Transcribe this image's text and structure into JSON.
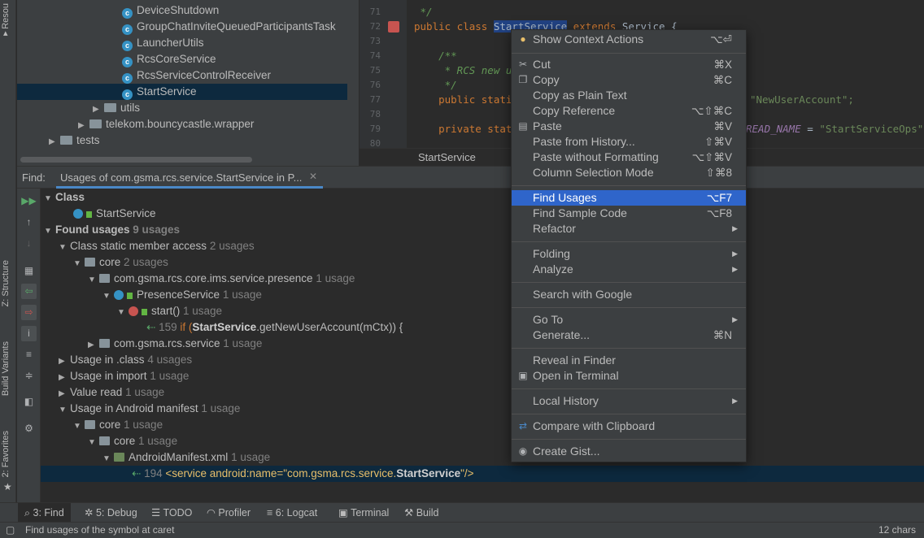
{
  "left_strip": {
    "resource": "Resou",
    "structure": "Z: Structure",
    "build_variants": "Build Variants",
    "favorites": "2: Favorites"
  },
  "project_tree": [
    {
      "label": "DeviceShutdown",
      "type": "class"
    },
    {
      "label": "GroupChatInviteQueuedParticipantsTask",
      "type": "class"
    },
    {
      "label": "LauncherUtils",
      "type": "class"
    },
    {
      "label": "RcsCoreService",
      "type": "class"
    },
    {
      "label": "RcsServiceControlReceiver",
      "type": "class"
    },
    {
      "label": "StartService",
      "type": "class",
      "selected": true
    },
    {
      "label": "utils",
      "type": "folder"
    },
    {
      "label": "telekom.bouncycastle.wrapper",
      "type": "folder"
    },
    {
      "label": "tests",
      "type": "folder"
    }
  ],
  "editor": {
    "lines": [
      {
        "n": "71",
        "text": " */"
      },
      {
        "n": "72",
        "k": "public class ",
        "h": "StartService",
        "k2": " extends ",
        "r": "Service {"
      },
      {
        "n": "73",
        "text": ""
      },
      {
        "n": "74",
        "text": "    /**"
      },
      {
        "n": "75",
        "text": "     * RCS new us"
      },
      {
        "n": "76",
        "text": "     */"
      },
      {
        "n": "77",
        "k": "    public static",
        "tail": "\"NewUserAccount\";"
      },
      {
        "n": "78",
        "text": ""
      },
      {
        "n": "79",
        "k": "    private stati",
        "tail2": "READ_NAME",
        "tail3": " = ",
        "tail4": "\"StartServiceOps\";"
      },
      {
        "n": "80",
        "text": ""
      }
    ],
    "breadcrumb": "StartService"
  },
  "find": {
    "label": "Find:",
    "tab": "Usages of com.gsma.rcs.service.StartService in P...",
    "rows": [
      {
        "depth": 0,
        "arrow": "▼",
        "text": "Class",
        "bold": true
      },
      {
        "depth": 1,
        "icon": "class",
        "text": "StartService"
      },
      {
        "depth": 0,
        "arrow": "▼",
        "text": "Found usages",
        "bold": true,
        "count": "9 usages"
      },
      {
        "depth": 1,
        "arrow": "▼",
        "text": "Class static member access",
        "count": "2 usages"
      },
      {
        "depth": 2,
        "arrow": "▼",
        "icon": "module",
        "text": "core",
        "count": "2 usages"
      },
      {
        "depth": 3,
        "arrow": "▼",
        "icon": "package",
        "text": "com.gsma.rcs.core.ims.service.presence",
        "count": "1 usage"
      },
      {
        "depth": 4,
        "arrow": "▼",
        "icon": "class",
        "text": "PresenceService",
        "count": "1 usage"
      },
      {
        "depth": 5,
        "arrow": "▼",
        "icon": "method",
        "text": "start()",
        "count": "1 usage"
      },
      {
        "depth": 6,
        "icon": "usage",
        "line": "159",
        "pre": "if (",
        "strong": "StartService",
        "post": ".getNewUserAccount(mCtx)) {"
      },
      {
        "depth": 3,
        "arrow": "▶",
        "icon": "package",
        "text": "com.gsma.rcs.service",
        "count": "1 usage"
      },
      {
        "depth": 1,
        "arrow": "▶",
        "text": "Usage in .class",
        "count": "4 usages"
      },
      {
        "depth": 1,
        "arrow": "▶",
        "text": "Usage in import",
        "count": "1 usage"
      },
      {
        "depth": 1,
        "arrow": "▶",
        "text": "Value read",
        "count": "1 usage"
      },
      {
        "depth": 1,
        "arrow": "▼",
        "text": "Usage in Android manifest",
        "count": "1 usage"
      },
      {
        "depth": 2,
        "arrow": "▼",
        "icon": "module",
        "text": "core",
        "count": "1 usage"
      },
      {
        "depth": 3,
        "arrow": "▼",
        "icon": "module2",
        "text": "core",
        "count": "1 usage"
      },
      {
        "depth": 4,
        "arrow": "▼",
        "icon": "xml",
        "text": "AndroidManifest.xml",
        "count": "1 usage"
      },
      {
        "depth": 5,
        "icon": "usage",
        "line": "194",
        "pre": "<service android:name=\"com.gsma.rcs.service.",
        "strong": "StartService",
        "post": "\"/>",
        "selected": true
      }
    ]
  },
  "context_menu": {
    "items": [
      {
        "icon": "bulb-icon",
        "label": "Show Context Actions",
        "shortcut": "⌥⏎"
      },
      {
        "sep": true
      },
      {
        "icon": "cut-icon",
        "label": "Cut",
        "shortcut": "⌘X"
      },
      {
        "icon": "copy-icon",
        "label": "Copy",
        "shortcut": "⌘C"
      },
      {
        "label": "Copy as Plain Text"
      },
      {
        "label": "Copy Reference",
        "shortcut": "⌥⇧⌘C"
      },
      {
        "icon": "paste-icon",
        "label": "Paste",
        "shortcut": "⌘V"
      },
      {
        "label": "Paste from History...",
        "shortcut": "⇧⌘V"
      },
      {
        "label": "Paste without Formatting",
        "shortcut": "⌥⇧⌘V"
      },
      {
        "label": "Column Selection Mode",
        "shortcut": "⇧⌘8"
      },
      {
        "sep": true
      },
      {
        "label": "Find Usages",
        "shortcut": "⌥F7",
        "highlighted": true
      },
      {
        "label": "Find Sample Code",
        "shortcut": "⌥F8"
      },
      {
        "label": "Refactor",
        "submenu": true
      },
      {
        "sep": true
      },
      {
        "label": "Folding",
        "submenu": true
      },
      {
        "label": "Analyze",
        "submenu": true
      },
      {
        "sep": true
      },
      {
        "label": "Search with Google"
      },
      {
        "sep": true
      },
      {
        "label": "Go To",
        "submenu": true
      },
      {
        "label": "Generate...",
        "shortcut": "⌘N"
      },
      {
        "sep": true
      },
      {
        "label": "Reveal in Finder"
      },
      {
        "icon": "terminal-icon",
        "label": "Open in Terminal"
      },
      {
        "sep": true
      },
      {
        "label": "Local History",
        "submenu": true
      },
      {
        "sep": true
      },
      {
        "icon": "compare-icon",
        "label": "Compare with Clipboard"
      },
      {
        "sep": true
      },
      {
        "icon": "github-icon",
        "label": "Create Gist..."
      }
    ]
  },
  "bottom_tabs": [
    {
      "icon": "search-icon",
      "label": "3: Find",
      "active": true
    },
    {
      "icon": "bug-icon",
      "label": "5: Debug"
    },
    {
      "icon": "list-icon",
      "label": "TODO"
    },
    {
      "icon": "gauge-icon",
      "label": "Profiler"
    },
    {
      "icon": "logcat-icon",
      "label": "6: Logcat"
    },
    {
      "icon": "terminal-icon",
      "label": "Terminal"
    },
    {
      "icon": "hammer-icon",
      "label": "Build"
    }
  ],
  "status": {
    "message": "Find usages of the symbol at caret",
    "chars": "12 chars"
  }
}
